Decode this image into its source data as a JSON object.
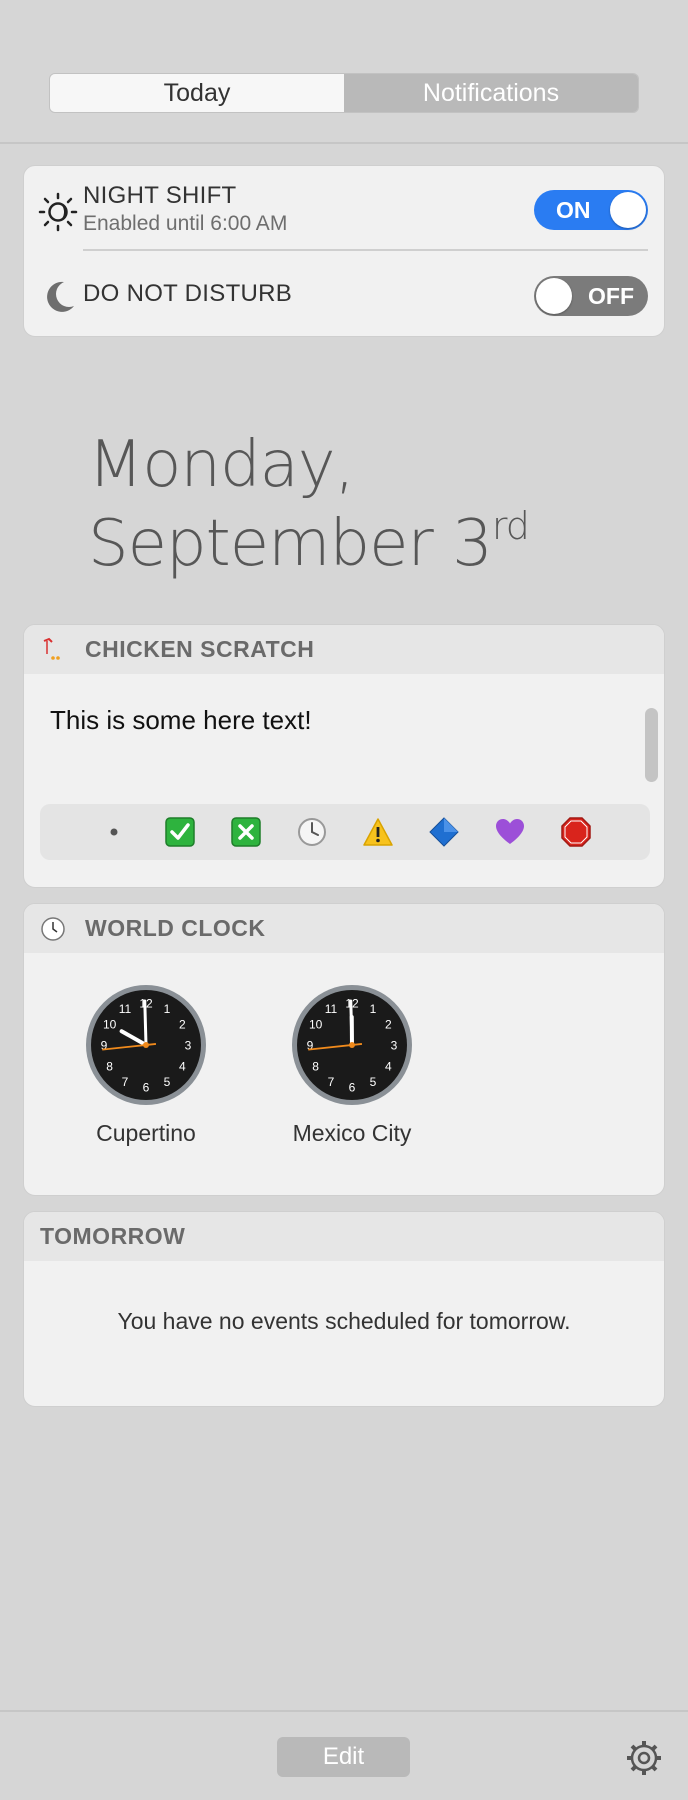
{
  "tabs": [
    {
      "label": "Today",
      "active": true
    },
    {
      "label": "Notifications",
      "active": false
    }
  ],
  "night_shift": {
    "icon": "night-shift-icon",
    "title": "NIGHT SHIFT",
    "subtitle": "Enabled until 6:00 AM",
    "switch_label": "ON"
  },
  "do_not_disturb": {
    "icon": "moon-icon",
    "title": "DO NOT DISTURB",
    "switch_label": "OFF"
  },
  "date": {
    "weekday": "Monday,",
    "month_day": "September 3",
    "suffix": "rd"
  },
  "chicken_scratch": {
    "icon": "chicken-scratch-icon",
    "title": "CHICKEN SCRATCH",
    "text": "This is some here text!",
    "emoji_buttons": [
      "bullet",
      "check-mark",
      "cross-mark",
      "clock",
      "warning",
      "blue-diamond",
      "purple-heart",
      "stop-sign"
    ]
  },
  "world_clock": {
    "icon": "clock-icon",
    "title": "WORLD CLOCK",
    "clocks": [
      {
        "city": "Cupertino",
        "time": "09:59:44"
      },
      {
        "city": "Mexico City",
        "time": "11:59:44"
      }
    ]
  },
  "tomorrow": {
    "title": "TOMORROW",
    "message": "You have no events scheduled for tomorrow."
  },
  "footer": {
    "edit_label": "Edit"
  },
  "colors": {
    "background": "#d6d6d6",
    "card": "#f1f1f1",
    "toggle_on": "#2a7cf2",
    "toggle_off": "#7b7b7b"
  }
}
